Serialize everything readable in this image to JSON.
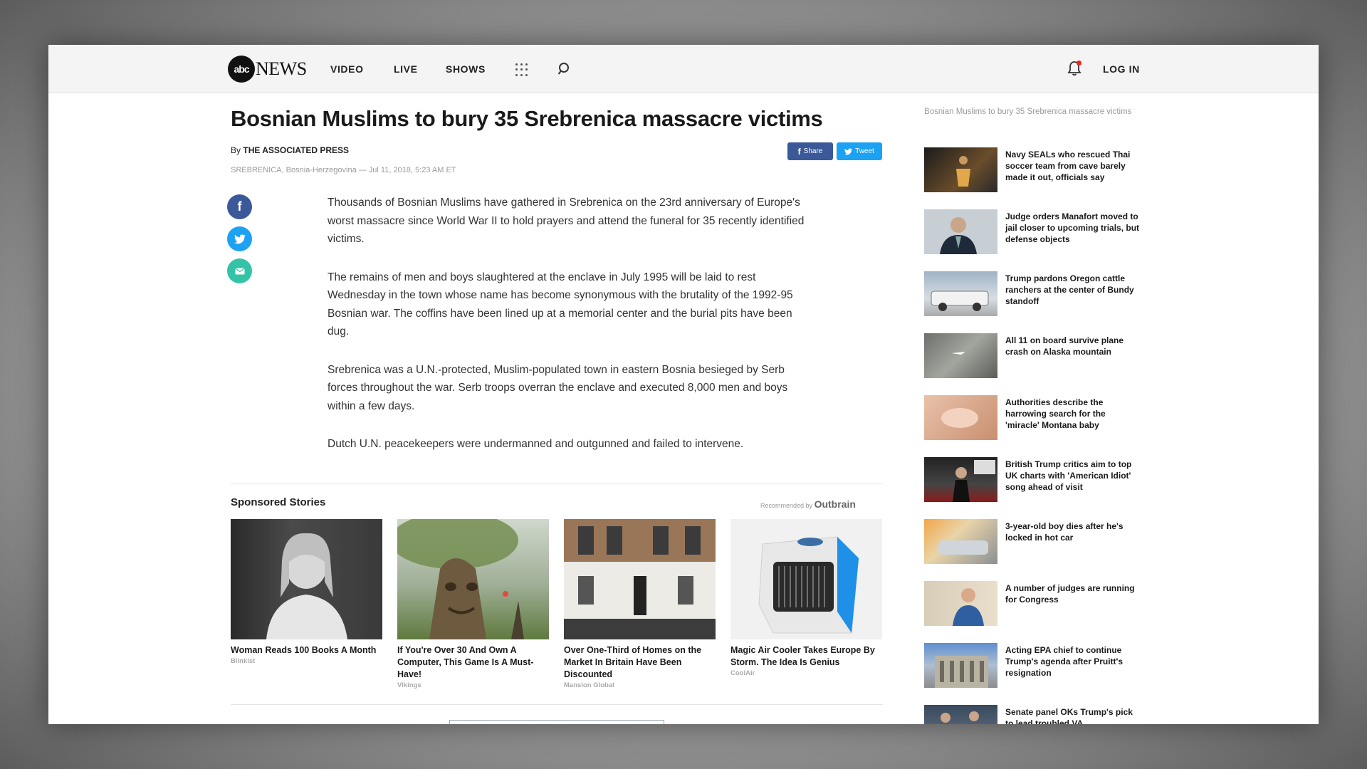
{
  "header": {
    "logo_circle": "abc",
    "logo_word": "NEWS",
    "nav": [
      "VIDEO",
      "LIVE",
      "SHOWS"
    ],
    "login": "LOG IN"
  },
  "article": {
    "headline": "Bosnian Muslims to bury 35 Srebrenica massacre victims",
    "byline_prefix": "By",
    "byline_author": "THE ASSOCIATED PRESS",
    "dateline": "SREBRENICA, Bosnia-Herzegovina — Jul 11, 2018, 5:23 AM ET",
    "share_label": "Share",
    "tweet_label": "Tweet",
    "paragraphs": [
      "Thousands of Bosnian Muslims have gathered in Srebrenica on the 23rd anniversary of Europe's worst massacre since World War II to hold prayers and attend the funeral for 35 recently identified victims.",
      "The remains of men and boys slaughtered at the enclave in July 1995 will be laid to rest Wednesday in the town whose name has become synonymous with the brutality of the 1992-95 Bosnian war. The coffins have been lined up at a memorial center and the burial pits have been dug.",
      "Srebrenica was a U.N.-protected, Muslim-populated town in eastern Bosnia besieged by Serb forces throughout the war. Serb troops overran the enclave and executed 8,000 men and boys within a few days.",
      "Dutch U.N. peacekeepers were undermanned and outgunned and failed to intervene."
    ]
  },
  "sponsored": {
    "title": "Sponsored Stories",
    "recommended_by": "Recommended by",
    "outbrain": "Outbrain",
    "cards": [
      {
        "title": "Woman Reads 100 Books A Month",
        "source": "Blinkist"
      },
      {
        "title": "If You're Over 30 And Own A Computer, This Game Is A Must-Have!",
        "source": "Vikings"
      },
      {
        "title": "Over One-Third of Homes on the Market In Britain Have Been Discounted",
        "source": "Mansion Global"
      },
      {
        "title": "Magic Air Cooler Takes Europe By Storm. The Idea Is Genius",
        "source": "CoolAir"
      }
    ]
  },
  "sidebar": {
    "heading": "Bosnian Muslims to bury 35 Srebrenica massacre victims",
    "items": [
      "Navy SEALs who rescued Thai soccer team from cave barely made it out, officials say",
      "Judge orders Manafort moved to jail closer to upcoming trials, but defense objects",
      "Trump pardons Oregon cattle ranchers at the center of Bundy standoff",
      "All 11 on board survive plane crash on Alaska mountain",
      "Authorities describe the harrowing search for the 'miracle' Montana baby",
      "British Trump critics aim to top UK charts with 'American Idiot' song ahead of visit",
      "3-year-old boy dies after he's locked in hot car",
      "A number of judges are running for Congress",
      "Acting EPA chief to continue Trump's agenda after Pruitt's resignation",
      "Senate panel OKs Trump's pick to lead troubled VA"
    ]
  },
  "colors": {
    "facebook": "#3b5998",
    "twitter": "#1da1f2",
    "email": "#34c3a6",
    "notification_dot": "#e8261c"
  }
}
